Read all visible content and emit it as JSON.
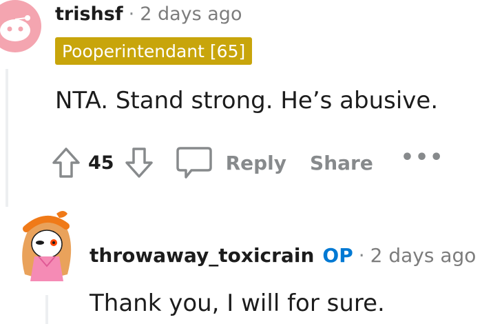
{
  "comment1": {
    "author": "trishsf",
    "separator": "·",
    "time": "2 days ago",
    "flair": "Pooperintendant [65]",
    "body": "NTA. Stand strong. He’s abusive.",
    "score": "45",
    "reply_label": "Reply",
    "share_label": "Share",
    "more_label": "•••"
  },
  "comment2": {
    "author": "throwaway_toxicrain",
    "op_badge": "OP",
    "separator": "·",
    "time": "2 days ago",
    "body": "Thank you, I will for sure."
  },
  "icons": {
    "upvote": "arrow-up-icon",
    "downvote": "arrow-down-icon",
    "reply": "speech-bubble-icon",
    "more": "ellipsis-icon"
  },
  "colors": {
    "flair_bg": "#c8a50b",
    "op_badge": "#0079d3",
    "muted": "#878a8c",
    "avatar1_bg": "#f4a5b0"
  }
}
